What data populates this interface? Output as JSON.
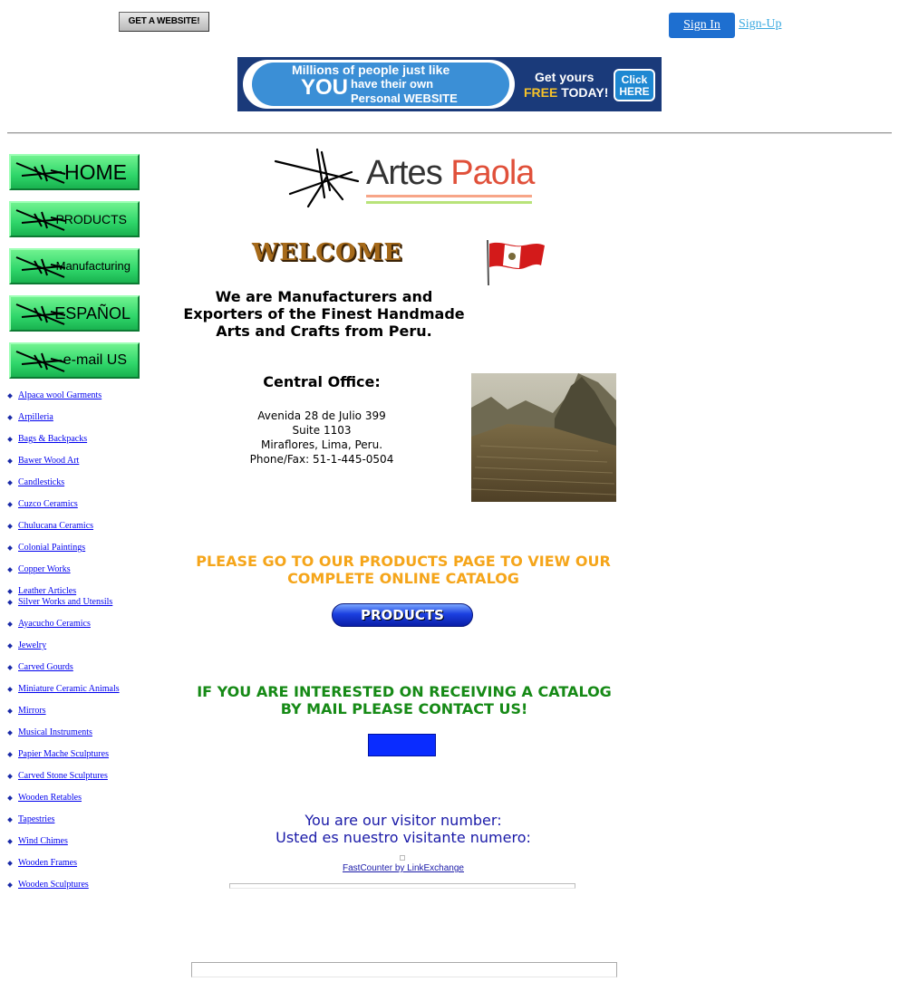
{
  "topbar": {
    "get_website": "GET A WEBSITE!",
    "sign_in": "Sign In",
    "sign_up": "Sign-Up"
  },
  "banner": {
    "line1": "Millions of people just like",
    "you": "YOU",
    "line2": "have their own",
    "line3": "Personal WEBSITE",
    "get_yours": "Get yours",
    "free": "FREE",
    "today": "TODAY!",
    "click": "Click",
    "here": "HERE"
  },
  "nav": {
    "home": "HOME",
    "products": "PRODUCTS",
    "manufacturing": "Manufacturing",
    "espanol": "ESPAÑOL",
    "email": "e-mail US"
  },
  "categories": [
    "Alpaca wool Garments",
    "Arpilleria",
    "Bags & Backpacks",
    "Bawer Wood Art",
    "Candlesticks",
    "Cuzco Ceramics",
    "Chulucana Ceramics",
    "Colonial Paintings",
    "Copper Works",
    "Leather Articles",
    "Silver Works and Utensils",
    "Ayacucho Ceramics",
    "Jewelry",
    "Carved Gourds",
    "Miniature Ceramic Animals",
    "Mirrors",
    "Musical Instruments",
    "Papier Mache Sculptures",
    "Carved Stone Sculptures",
    "Wooden Retables",
    "Tapestries",
    "Wind Chimes",
    "Wooden Frames",
    "Wooden Sculptures"
  ],
  "logo": {
    "artes": "Artes ",
    "paola": "Paola"
  },
  "welcome": "WELCOME",
  "mission": "We are Manufacturers and Exporters of the Finest Handmade Arts and Crafts from Peru.",
  "office": {
    "title": "Central Office:",
    "address": [
      "Avenida 28 de Julio 399",
      "Suite 1103",
      "Miraflores, Lima, Peru.",
      "Phone/Fax: 51-1-445-0504"
    ]
  },
  "go_products": "PLEASE GO TO OUR PRODUCTS PAGE TO VIEW OUR COMPLETE ONLINE CATALOG",
  "products_button": "PRODUCTS",
  "catalog_message": "IF YOU ARE INTERESTED ON RECEIVING A CATALOG BY MAIL PLEASE CONTACT US!",
  "visitor": {
    "en": "You are our visitor number:",
    "es": "Usted es nuestro visitante numero:",
    "fastcounter": "FastCounter by LinkExchange"
  },
  "colors": {
    "nav_green": "#2fd66a",
    "orange_text": "#f5a51a",
    "green_text": "#168a16",
    "visitor_text": "#1a1aa8",
    "sign_in_blue": "#1e6fd0"
  }
}
